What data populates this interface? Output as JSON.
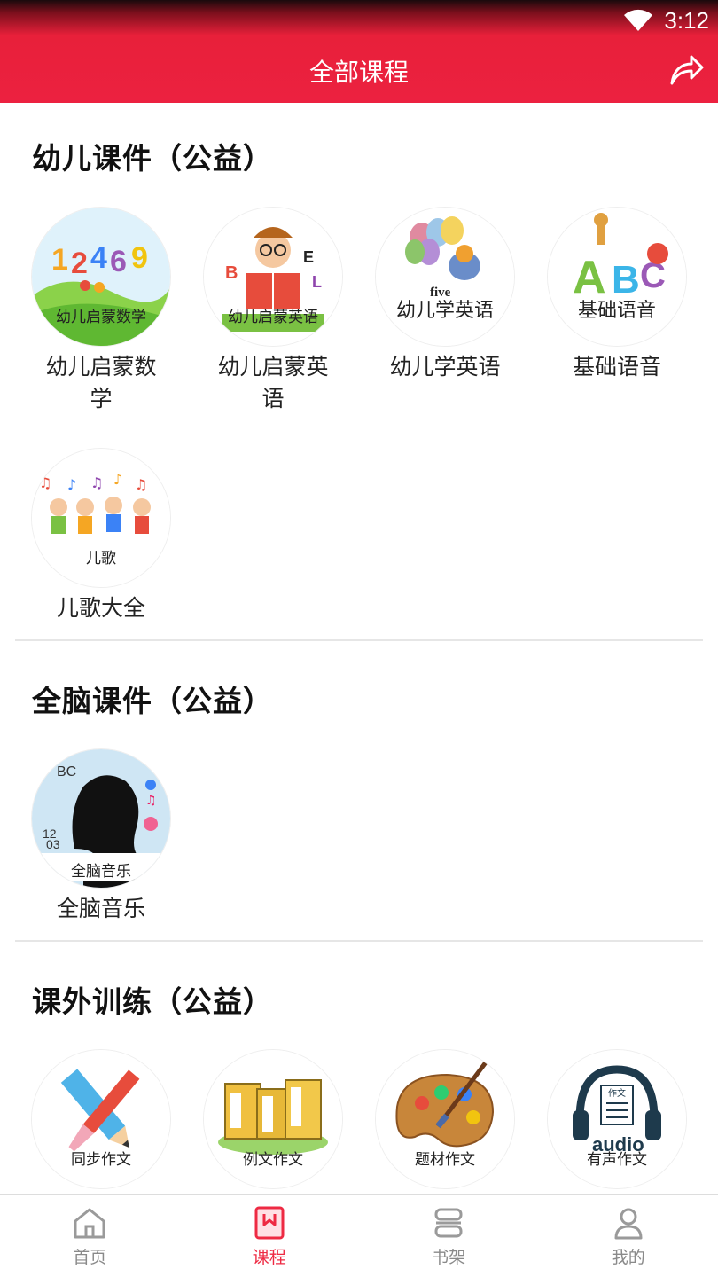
{
  "status": {
    "time": "3:12"
  },
  "header": {
    "title": "全部课程"
  },
  "sections": [
    {
      "title": "幼儿课件（公益）",
      "items": [
        {
          "caption": "幼儿启蒙数学",
          "label": "幼儿启蒙数学"
        },
        {
          "caption": "幼儿启蒙英语",
          "label": "幼儿启蒙英语"
        },
        {
          "caption": "幼儿学英语",
          "label": "幼儿学英语",
          "extra": "five"
        },
        {
          "caption": "基础语音",
          "label": "基础语音"
        },
        {
          "caption": "儿歌",
          "label": "儿歌大全"
        }
      ]
    },
    {
      "title": "全脑课件（公益）",
      "items": [
        {
          "caption": "全脑音乐",
          "label": "全脑音乐",
          "extra": "BC"
        }
      ]
    },
    {
      "title": "课外训练（公益）",
      "items": [
        {
          "caption": "同步作文"
        },
        {
          "caption": "例文作文"
        },
        {
          "caption": "题材作文"
        },
        {
          "caption": "有声作文",
          "extra": "audio",
          "badge": "作文"
        }
      ]
    }
  ],
  "tabbar": [
    {
      "label": "首页",
      "icon": "home-icon"
    },
    {
      "label": "课程",
      "icon": "course-icon",
      "active": true
    },
    {
      "label": "书架",
      "icon": "bookshelf-icon"
    },
    {
      "label": "我的",
      "icon": "profile-icon"
    }
  ],
  "colors": {
    "brand": "#ec2140",
    "active_tab": "#ee2a43",
    "inactive_tab": "#8a8a8a"
  }
}
